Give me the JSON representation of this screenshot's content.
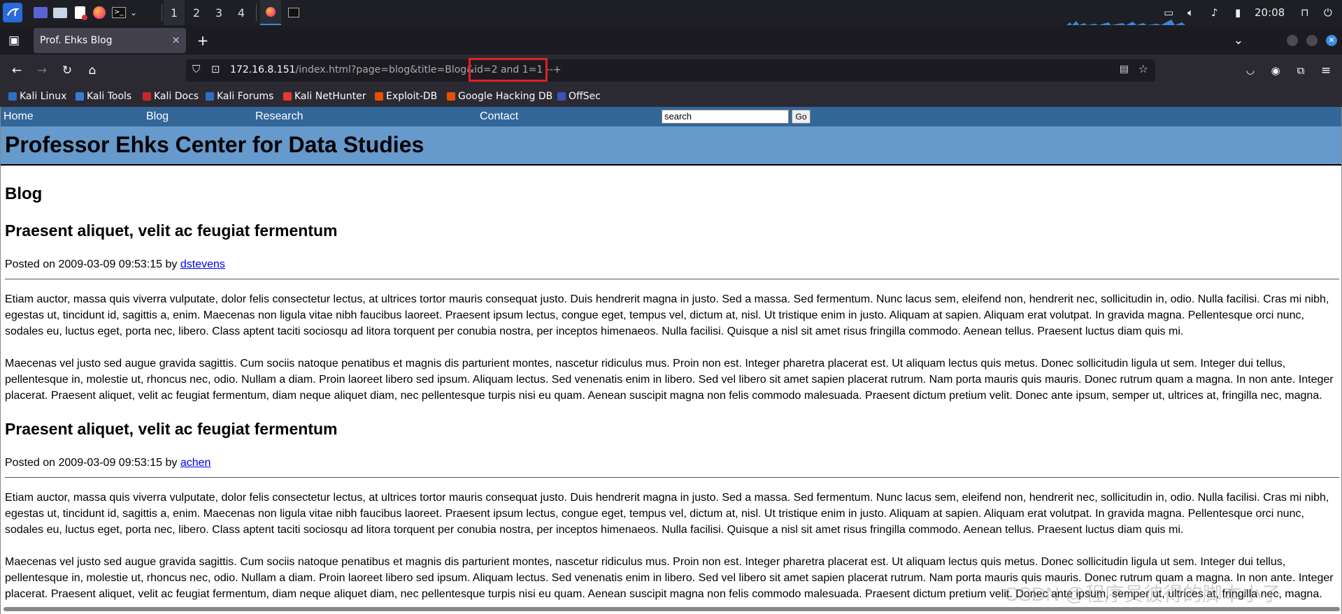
{
  "taskbar": {
    "workspaces": [
      "1",
      "2",
      "3",
      "4"
    ],
    "clock": "20:08",
    "icons": [
      "kali-menu-icon",
      "desktop-icon",
      "file-manager-icon",
      "text-editor-icon",
      "firefox-icon",
      "terminal-icon",
      "dropdown-icon"
    ]
  },
  "browser": {
    "tab_title": "Prof. Ehks Blog",
    "tab_close": "×",
    "new_tab": "+",
    "url_host": "172.16.8.151",
    "url_path": "/index.html?page=blog&title=Blog&id",
    "url_injected": "=2 and 1=1 --+",
    "bookmarks": [
      {
        "label": "Kali Linux",
        "color": "#2e6fc1"
      },
      {
        "label": "Kali Tools",
        "color": "#3a7bd5"
      },
      {
        "label": "Kali Docs",
        "color": "#c62828"
      },
      {
        "label": "Kali Forums",
        "color": "#2e6fc1"
      },
      {
        "label": "Kali NetHunter",
        "color": "#e53935"
      },
      {
        "label": "Exploit-DB",
        "color": "#e65100"
      },
      {
        "label": "Google Hacking DB",
        "color": "#e65100"
      },
      {
        "label": "OffSec",
        "color": "#3f51b5"
      }
    ]
  },
  "site": {
    "nav": [
      "Home",
      "Blog",
      "Research",
      "Contact"
    ],
    "search_value": "search",
    "go_label": "Go",
    "banner_title": "Professor Ehks Center for Data Studies",
    "section_title": "Blog",
    "posts": [
      {
        "title": "Praesent aliquet, velit ac feugiat fermentum",
        "posted_prefix": "Posted on 2009-03-09 09:53:15 by ",
        "author": "dstevens",
        "paragraphs": [
          "Etiam auctor, massa quis viverra vulputate, dolor felis consectetur lectus, at ultrices tortor mauris consequat justo. Duis hendrerit magna in justo. Sed a massa. Sed fermentum. Nunc lacus sem, eleifend non, hendrerit nec, sollicitudin in, odio. Nulla facilisi. Cras mi nibh, egestas ut, tincidunt id, sagittis a, enim. Maecenas non ligula vitae nibh faucibus laoreet. Praesent ipsum lectus, congue eget, tempus vel, dictum at, nisl. Ut tristique enim in justo. Aliquam at sapien. Aliquam erat volutpat. In gravida magna. Pellentesque orci nunc, sodales eu, luctus eget, porta nec, libero. Class aptent taciti sociosqu ad litora torquent per conubia nostra, per inceptos himenaeos. Nulla facilisi. Quisque a nisl sit amet risus fringilla commodo. Aenean tellus. Praesent luctus diam quis mi.",
          "Maecenas vel justo sed augue gravida sagittis. Cum sociis natoque penatibus et magnis dis parturient montes, nascetur ridiculus mus. Proin non est. Integer pharetra placerat est. Ut aliquam lectus quis metus. Donec sollicitudin ligula ut sem. Integer dui tellus, pellentesque in, molestie ut, rhoncus nec, odio. Nullam a diam. Proin laoreet libero sed ipsum. Aliquam lectus. Sed venenatis enim in libero. Sed vel libero sit amet sapien placerat rutrum. Nam porta mauris quis mauris. Donec rutrum quam a magna. In non ante. Integer placerat. Praesent aliquet, velit ac feugiat fermentum, diam neque aliquet diam, nec pellentesque turpis nisi eu quam. Aenean suscipit magna non felis commodo malesuada. Praesent dictum pretium velit. Donec ante ipsum, semper ut, ultrices at, fringilla nec, magna."
        ]
      },
      {
        "title": "Praesent aliquet, velit ac feugiat fermentum",
        "posted_prefix": "Posted on 2009-03-09 09:53:15 by ",
        "author": "achen",
        "paragraphs": [
          "Etiam auctor, massa quis viverra vulputate, dolor felis consectetur lectus, at ultrices tortor mauris consequat justo. Duis hendrerit magna in justo. Sed a massa. Sed fermentum. Nunc lacus sem, eleifend non, hendrerit nec, sollicitudin in, odio. Nulla facilisi. Cras mi nibh, egestas ut, tincidunt id, sagittis a, enim. Maecenas non ligula vitae nibh faucibus laoreet. Praesent ipsum lectus, congue eget, tempus vel, dictum at, nisl. Ut tristique enim in justo. Aliquam at sapien. Aliquam erat volutpat. In gravida magna. Pellentesque orci nunc, sodales eu, luctus eget, porta nec, libero. Class aptent taciti sociosqu ad litora torquent per conubia nostra, per inceptos himenaeos. Nulla facilisi. Quisque a nisl sit amet risus fringilla commodo. Aenean tellus. Praesent luctus diam quis mi.",
          "Maecenas vel justo sed augue gravida sagittis. Cum sociis natoque penatibus et magnis dis parturient montes, nascetur ridiculus mus. Proin non est. Integer pharetra placerat est. Ut aliquam lectus quis metus. Donec sollicitudin ligula ut sem. Integer dui tellus, pellentesque in, molestie ut, rhoncus nec, odio. Nullam a diam. Proin laoreet libero sed ipsum. Aliquam lectus. Sed venenatis enim in libero. Sed vel libero sit amet sapien placerat rutrum. Nam porta mauris quis mauris. Donec rutrum quam a magna. In non ante. Integer placerat. Praesent aliquet, velit ac feugiat fermentum, diam neque aliquet diam, nec pellentesque turpis nisi eu quam. Aenean suscipit magna non felis commodo malesuada. Praesent dictum pretium velit. Donec ante ipsum, semper ut, ultrices at, fringilla nec, magna."
        ]
      }
    ]
  },
  "watermark": "CSDN @程序员彼得的脚本小子"
}
